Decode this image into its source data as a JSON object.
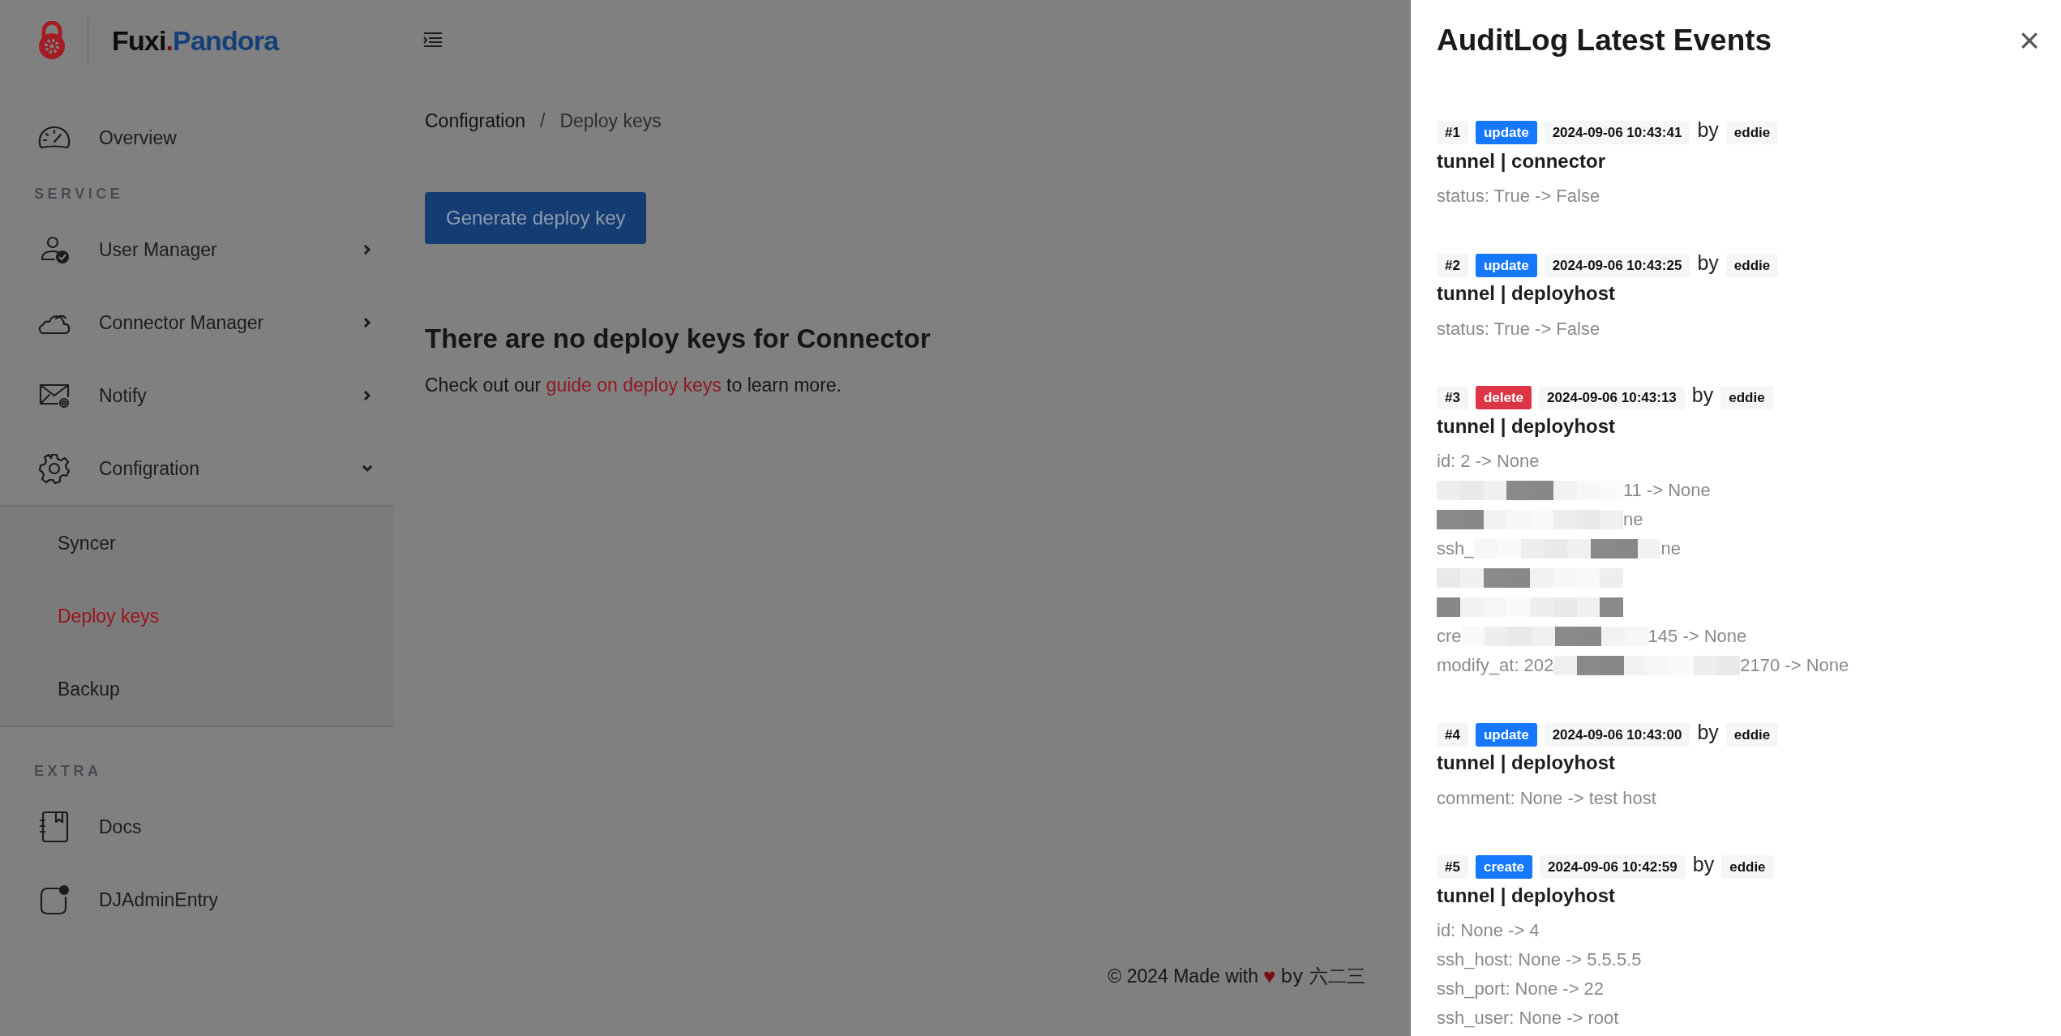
{
  "brand": {
    "first": "Fuxi",
    "dot": ".",
    "second": "Pandora"
  },
  "sidebar": {
    "sections": [
      {
        "items": [
          {
            "label": "Overview"
          }
        ]
      },
      {
        "title": "SERVICE",
        "items": [
          {
            "label": "User Manager",
            "expanded": false
          },
          {
            "label": "Connector Manager",
            "expanded": false
          },
          {
            "label": "Notify",
            "expanded": false
          },
          {
            "label": "Configration",
            "expanded": true,
            "children": [
              {
                "label": "Syncer",
                "selected": false
              },
              {
                "label": "Deploy keys",
                "selected": true
              },
              {
                "label": "Backup",
                "selected": false
              }
            ]
          }
        ]
      },
      {
        "title": "EXTRA",
        "items": [
          {
            "label": "Docs"
          },
          {
            "label": "DJAdminEntry"
          }
        ]
      }
    ]
  },
  "breadcrumb": [
    "Configration",
    "Deploy keys"
  ],
  "breadcrumb_separator": "/",
  "primary_button": "Generate deploy key",
  "empty_state": {
    "heading": "There are no deploy keys for Connector",
    "before": "Check out our ",
    "link": "guide on deploy keys",
    "after": " to learn more."
  },
  "footer": {
    "before": "© 2024 Made with",
    "heart": "♥",
    "after": "by 六二三"
  },
  "drawer": {
    "title": "AuditLog Latest Events",
    "close": "×",
    "events": [
      {
        "number": "#1",
        "action": "update",
        "color": "#1677ff",
        "time": "2024-09-06 10:43:41",
        "by": "by",
        "user": "eddie",
        "target": "tunnel | connector",
        "changes": [
          {
            "before": "status: True -> False",
            "redacted": false
          }
        ]
      },
      {
        "number": "#2",
        "action": "update",
        "color": "#1677ff",
        "time": "2024-09-06 10:43:25",
        "by": "by",
        "user": "eddie",
        "target": "tunnel | deployhost",
        "changes": [
          {
            "before": "status: True -> False",
            "redacted": false
          }
        ]
      },
      {
        "number": "#3",
        "action": "delete",
        "color": "#dc3545",
        "time": "2024-09-06 10:43:13",
        "by": "by",
        "user": "eddie",
        "target": "tunnel | deployhost",
        "changes": [
          {
            "before": "id: 2 -> None",
            "redacted": false
          },
          {
            "after": "11 -> None",
            "redacted": true
          },
          {
            "after": "ne",
            "redacted": true
          },
          {
            "before": "ssh_",
            "after": "ne",
            "redacted": true
          },
          {
            "redacted": true
          },
          {
            "redacted": true
          },
          {
            "before": "cre",
            "after": "145 -> None",
            "redacted": true
          },
          {
            "before": "modify_at: 202",
            "after": "2170 -> None",
            "redacted": true
          }
        ]
      },
      {
        "number": "#4",
        "action": "update",
        "color": "#1677ff",
        "time": "2024-09-06 10:43:00",
        "by": "by",
        "user": "eddie",
        "target": "tunnel | deployhost",
        "changes": [
          {
            "before": "comment: None -> test host",
            "redacted": false
          }
        ]
      },
      {
        "number": "#5",
        "action": "create",
        "color": "#1677ff",
        "time": "2024-09-06 10:42:59",
        "by": "by",
        "user": "eddie",
        "target": "tunnel | deployhost",
        "changes": [
          {
            "before": "id: None -> 4",
            "redacted": false
          },
          {
            "before": "ssh_host: None -> 5.5.5.5",
            "redacted": false
          },
          {
            "before": "ssh_port: None -> 22",
            "redacted": false
          },
          {
            "before": "ssh_user: None -> root",
            "redacted": false
          }
        ]
      }
    ]
  }
}
